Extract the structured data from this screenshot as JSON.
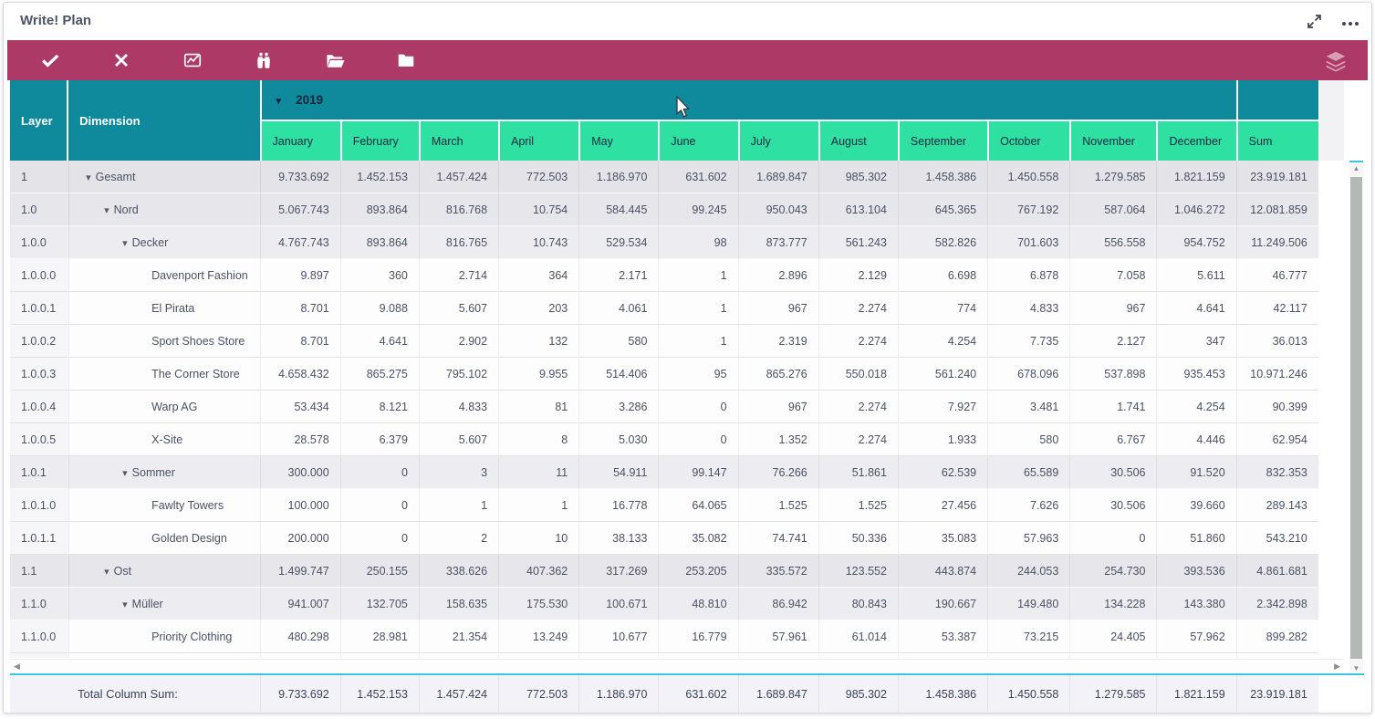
{
  "window": {
    "title": "Write! Plan"
  },
  "titlebar": {
    "icons": [
      "expand-icon",
      "more-options-icon"
    ]
  },
  "toolbar": {
    "background": "#ad3a66",
    "icons": [
      "confirm-icon",
      "cancel-icon",
      "chart-icon",
      "binoculars-icon",
      "folder-open-icon",
      "folder-icon",
      "layers-icon"
    ]
  },
  "table": {
    "layer_label": "Layer",
    "dimension_label": "Dimension",
    "year_label": "2019",
    "sum_label": "Sum",
    "months": [
      "January",
      "February",
      "March",
      "April",
      "May",
      "June",
      "July",
      "August",
      "September",
      "October",
      "November",
      "December"
    ],
    "rows": [
      {
        "layer": "1",
        "name": "Gesamt",
        "level": 0,
        "group": true,
        "values": [
          "9.733.692",
          "1.452.153",
          "1.457.424",
          "772.503",
          "1.186.970",
          "631.602",
          "1.689.847",
          "985.302",
          "1.458.386",
          "1.450.558",
          "1.279.585",
          "1.821.159",
          "23.919.181"
        ]
      },
      {
        "layer": "1.0",
        "name": "Nord",
        "level": 1,
        "group": true,
        "values": [
          "5.067.743",
          "893.864",
          "816.768",
          "10.754",
          "584.445",
          "99.245",
          "950.043",
          "613.104",
          "645.365",
          "767.192",
          "587.064",
          "1.046.272",
          "12.081.859"
        ]
      },
      {
        "layer": "1.0.0",
        "name": "Decker",
        "level": 2,
        "group": true,
        "values": [
          "4.767.743",
          "893.864",
          "816.765",
          "10.743",
          "529.534",
          "98",
          "873.777",
          "561.243",
          "582.826",
          "701.603",
          "556.558",
          "954.752",
          "11.249.506"
        ]
      },
      {
        "layer": "1.0.0.0",
        "name": "Davenport Fashion",
        "level": 3,
        "group": false,
        "values": [
          "9.897",
          "360",
          "2.714",
          "364",
          "2.171",
          "1",
          "2.896",
          "2.129",
          "6.698",
          "6.878",
          "7.058",
          "5.611",
          "46.777"
        ]
      },
      {
        "layer": "1.0.0.1",
        "name": "El Pirata",
        "level": 3,
        "group": false,
        "values": [
          "8.701",
          "9.088",
          "5.607",
          "203",
          "4.061",
          "1",
          "967",
          "2.274",
          "774",
          "4.833",
          "967",
          "4.641",
          "42.117"
        ]
      },
      {
        "layer": "1.0.0.2",
        "name": "Sport Shoes Store",
        "level": 3,
        "group": false,
        "values": [
          "8.701",
          "4.641",
          "2.902",
          "132",
          "580",
          "1",
          "2.319",
          "2.274",
          "4.254",
          "7.735",
          "2.127",
          "347",
          "36.013"
        ]
      },
      {
        "layer": "1.0.0.3",
        "name": "The Corner Store",
        "level": 3,
        "group": false,
        "values": [
          "4.658.432",
          "865.275",
          "795.102",
          "9.955",
          "514.406",
          "95",
          "865.276",
          "550.018",
          "561.240",
          "678.096",
          "537.898",
          "935.453",
          "10.971.246"
        ]
      },
      {
        "layer": "1.0.0.4",
        "name": "Warp AG",
        "level": 3,
        "group": false,
        "values": [
          "53.434",
          "8.121",
          "4.833",
          "81",
          "3.286",
          "0",
          "967",
          "2.274",
          "7.927",
          "3.481",
          "1.741",
          "4.254",
          "90.399"
        ]
      },
      {
        "layer": "1.0.0.5",
        "name": "X-Site",
        "level": 3,
        "group": false,
        "values": [
          "28.578",
          "6.379",
          "5.607",
          "8",
          "5.030",
          "0",
          "1.352",
          "2.274",
          "1.933",
          "580",
          "6.767",
          "4.446",
          "62.954"
        ]
      },
      {
        "layer": "1.0.1",
        "name": "Sommer",
        "level": 2,
        "group": true,
        "values": [
          "300.000",
          "0",
          "3",
          "11",
          "54.911",
          "99.147",
          "76.266",
          "51.861",
          "62.539",
          "65.589",
          "30.506",
          "91.520",
          "832.353"
        ]
      },
      {
        "layer": "1.0.1.0",
        "name": "Fawlty Towers",
        "level": 3,
        "group": false,
        "values": [
          "100.000",
          "0",
          "1",
          "1",
          "16.778",
          "64.065",
          "1.525",
          "1.525",
          "27.456",
          "7.626",
          "30.506",
          "39.660",
          "289.143"
        ]
      },
      {
        "layer": "1.0.1.1",
        "name": "Golden Design",
        "level": 3,
        "group": false,
        "values": [
          "200.000",
          "0",
          "2",
          "10",
          "38.133",
          "35.082",
          "74.741",
          "50.336",
          "35.083",
          "57.963",
          "0",
          "51.860",
          "543.210"
        ]
      },
      {
        "layer": "1.1",
        "name": "Ost",
        "level": 1,
        "group": true,
        "values": [
          "1.499.747",
          "250.155",
          "338.626",
          "407.362",
          "317.269",
          "253.205",
          "335.572",
          "123.552",
          "443.874",
          "244.053",
          "254.730",
          "393.536",
          "4.861.681"
        ]
      },
      {
        "layer": "1.1.0",
        "name": "Müller",
        "level": 2,
        "group": true,
        "values": [
          "941.007",
          "132.705",
          "158.635",
          "175.530",
          "100.671",
          "48.810",
          "86.942",
          "80.843",
          "190.667",
          "149.480",
          "134.228",
          "143.380",
          "2.342.898"
        ]
      },
      {
        "layer": "1.1.0.0",
        "name": "Priority Clothing",
        "level": 3,
        "group": false,
        "values": [
          "480.298",
          "28.981",
          "21.354",
          "13.249",
          "10.677",
          "16.779",
          "57.961",
          "61.014",
          "53.387",
          "73.215",
          "24.405",
          "57.962",
          "899.282"
        ]
      }
    ],
    "footer": {
      "label": "Total Column Sum:",
      "values": [
        "9.733.692",
        "1.452.153",
        "1.457.424",
        "772.503",
        "1.186.970",
        "631.602",
        "1.689.847",
        "985.302",
        "1.458.386",
        "1.450.558",
        "1.279.585",
        "1.821.159",
        "23.919.181"
      ]
    }
  },
  "colors": {
    "toolbar_magenta": "#ad3a66",
    "header_teal": "#0f8a9d",
    "header_green": "#2ee0a2",
    "footer_border_cyan": "#3ec6e0"
  }
}
